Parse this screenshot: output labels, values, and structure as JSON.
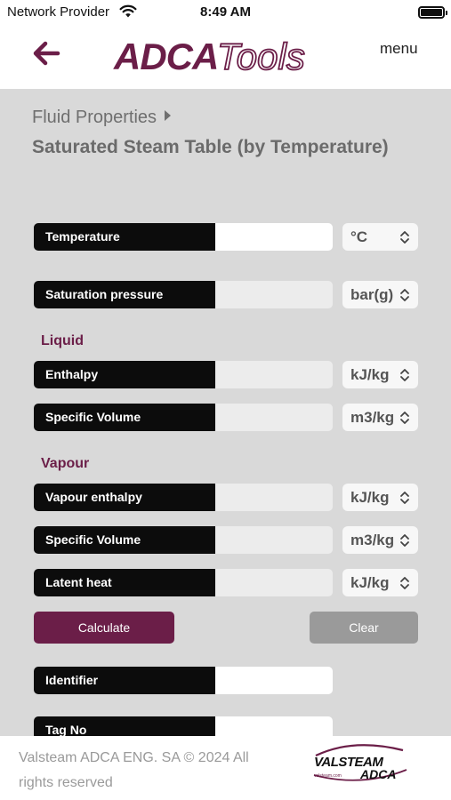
{
  "status_bar": {
    "carrier": "Network Provider",
    "time": "8:49 AM"
  },
  "header": {
    "logo_text": "ADCATools",
    "menu_label": "menu"
  },
  "page": {
    "breadcrumb": "Fluid Properties",
    "title": "Saturated Steam Table (by Temperature)"
  },
  "fields": {
    "temperature": {
      "label": "Temperature",
      "value": "",
      "unit": "°C"
    },
    "saturation_pressure": {
      "label": "Saturation pressure",
      "value": "",
      "unit": "bar(g)"
    },
    "liquid_section": "Liquid",
    "liquid_enthalpy": {
      "label": "Enthalpy",
      "value": "",
      "unit": "kJ/kg"
    },
    "liquid_specific_volume": {
      "label": "Specific Volume",
      "value": "",
      "unit": "m3/kg"
    },
    "vapour_section": "Vapour",
    "vapour_enthalpy": {
      "label": "Vapour enthalpy",
      "value": "",
      "unit": "kJ/kg"
    },
    "vapour_specific_volume": {
      "label": "Specific Volume",
      "value": "",
      "unit": "m3/kg"
    },
    "latent_heat": {
      "label": "Latent heat",
      "value": "",
      "unit": "kJ/kg"
    },
    "identifier": {
      "label": "Identifier",
      "value": ""
    },
    "tag_no": {
      "label": "Tag No",
      "value": ""
    }
  },
  "buttons": {
    "calculate": "Calculate",
    "clear": "Clear"
  },
  "footer": {
    "copyright": "Valsteam ADCA ENG. SA © 2024 All rights reserved",
    "logo_text": "VALSTEAM ADCA",
    "logo_url_text": "valsteam.com"
  },
  "colors": {
    "brand": "#6b1e48",
    "label_bg": "#0c0c0c",
    "panel_bg": "#d9d9d9"
  }
}
